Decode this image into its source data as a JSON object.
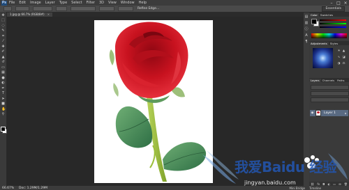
{
  "app": {
    "logo": "Ps",
    "menus": [
      "File",
      "Edit",
      "Image",
      "Layer",
      "Type",
      "Select",
      "Filter",
      "3D",
      "View",
      "Window",
      "Help"
    ],
    "window_controls": [
      "–",
      "□",
      "×"
    ]
  },
  "options_bar": {
    "option_label": "Refine Edge...",
    "workspace": "Essentials"
  },
  "document": {
    "tab_title": "1.jpg @ 66.7% (RGB/8#)",
    "tab_close": "×"
  },
  "status": {
    "zoom": "66.67%",
    "doc_info": "Doc: 1.29M/1.29M",
    "bottom_tabs": [
      "Mini Bridge",
      "Timeline"
    ]
  },
  "right_panels": {
    "color_tabs": [
      "Color",
      "Swatches"
    ],
    "adjust_tabs": [
      "Adjustments",
      "Styles"
    ],
    "layers_tabs": [
      "Layers",
      "Channels",
      "Paths"
    ],
    "layer_name": "Layer 1",
    "footer_icons": [
      "link-icon",
      "fx-icon",
      "mask-icon",
      "adjust-icon",
      "folder-icon",
      "new-layer-icon",
      "trash-icon"
    ]
  },
  "watermark": {
    "text": "我爱Baidu 经验",
    "url": "jingyan.baidu.com"
  },
  "colors": {
    "rose_red": "#c8121f",
    "leaf_green": "#3e8a56",
    "stem_green": "#9bbf3a",
    "ui_dark": "#282828",
    "layer_selected": "#596a82"
  }
}
